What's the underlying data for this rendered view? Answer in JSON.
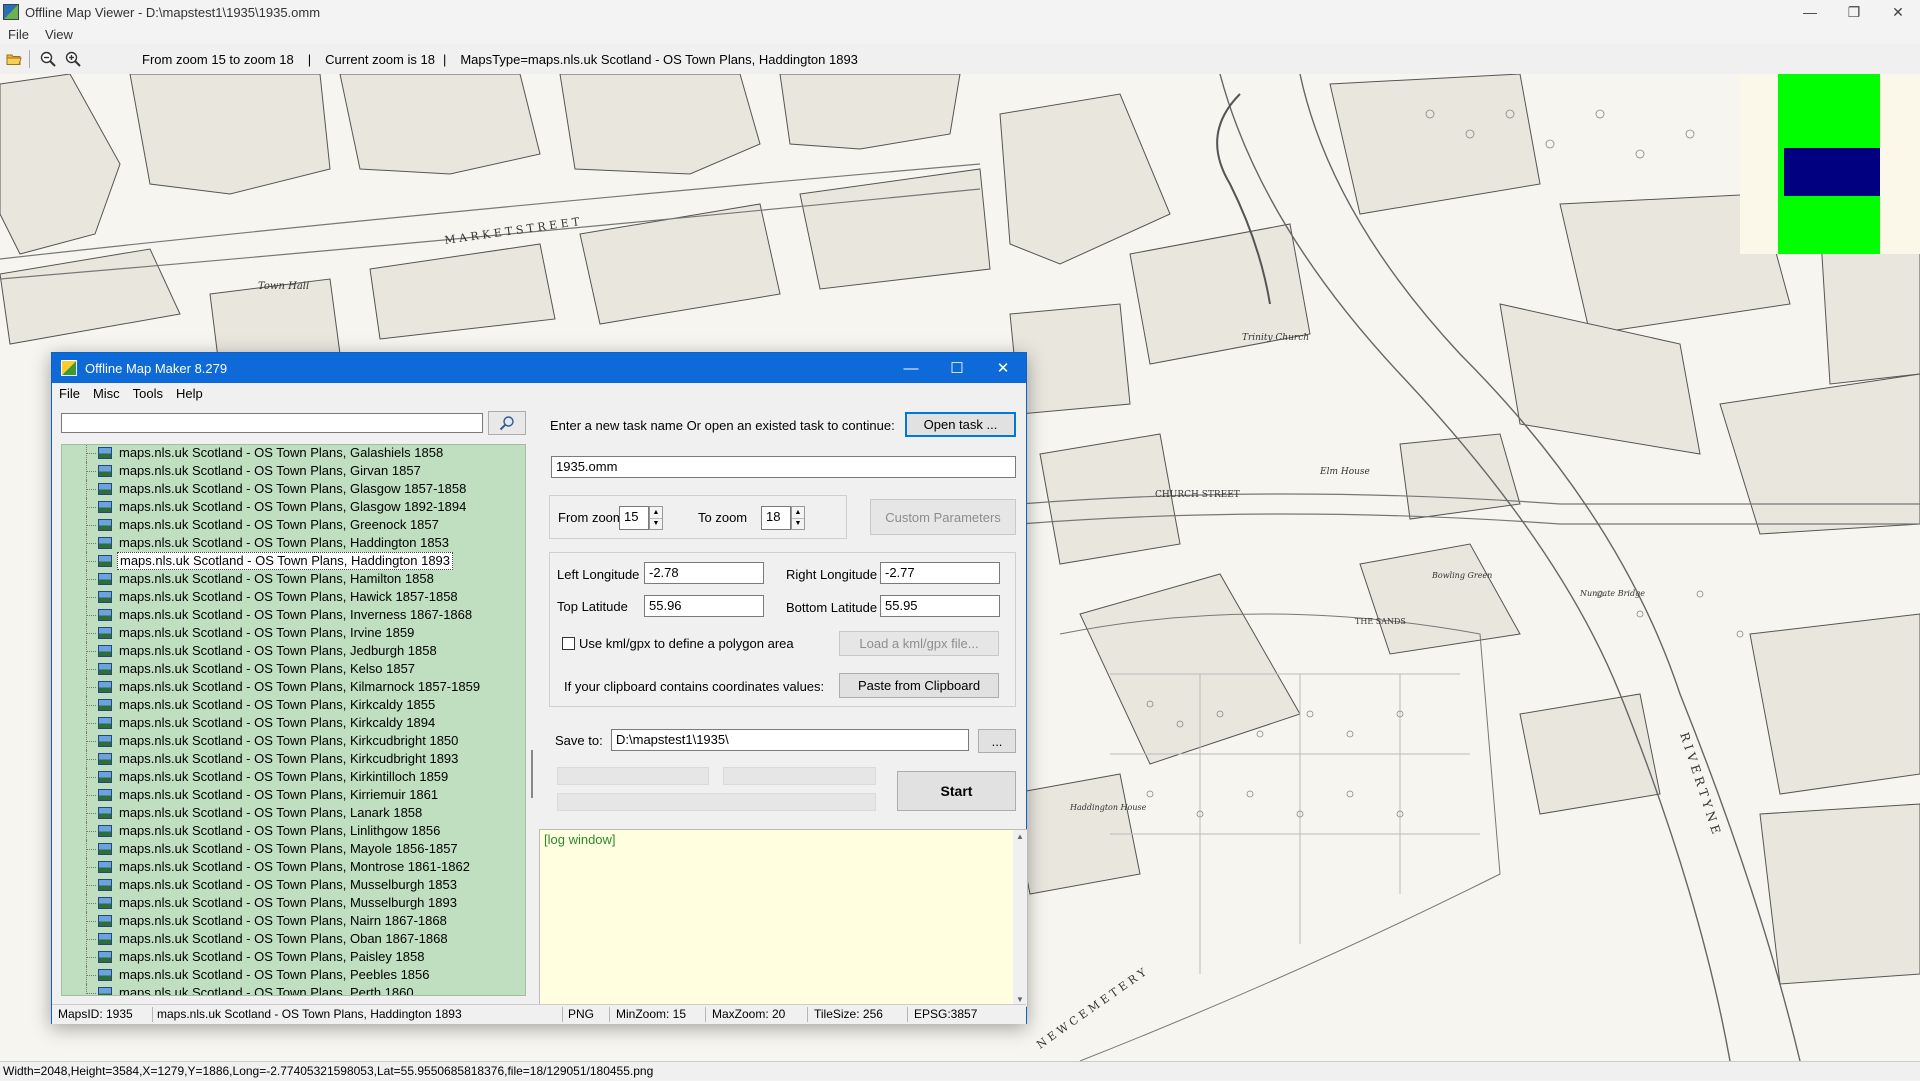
{
  "window": {
    "title": "Offline Map Viewer - D:\\mapstest1\\1935\\1935.omm",
    "controls": {
      "minimize": "—",
      "maximize": "❐",
      "close": "✕"
    }
  },
  "menu": [
    "File",
    "View"
  ],
  "toolbar": {
    "zoom_range": "From zoom 15 to zoom 18",
    "current_zoom": "Current zoom is 18",
    "maps_type": "MapsType=maps.nls.uk Scotland - OS Town Plans, Haddington 1893",
    "icons": [
      "open-folder-icon",
      "zoom-out-icon",
      "zoom-in-icon"
    ]
  },
  "overview_colors": {
    "background": "#fbf8ea",
    "area": "#00ff00",
    "view": "#000080"
  },
  "map_labels": {
    "market_street": "M A R K E T   S T R E E T",
    "church_street": "CHURCH  STREET",
    "town_hall": "Town Hall",
    "trinity_church": "Trinity Church",
    "elm_house": "Elm House",
    "river": "R I V E R   T Y N E",
    "cemetery": "N E W   C E M E T E R Y",
    "haddington_house": "Haddington House",
    "bowling_green": "Bowling Green",
    "nungate_bridge": "Nungate Bridge",
    "the_sands": "THE SANDS"
  },
  "status_bar": "Width=2048,Height=3584,X=1279,Y=1886,Long=-2.77405321598053,Lat=55.9550685818376,file=18/129051/180455.png",
  "dialog": {
    "title": "Offline Map Maker 8.279",
    "controls": {
      "minimize": "—",
      "maximize": "☐",
      "close": "✕"
    },
    "menu": [
      "File",
      "Misc",
      "Tools",
      "Help"
    ],
    "search": {
      "value": "",
      "icon": "search-icon"
    },
    "maps_list": [
      "maps.nls.uk Scotland - OS Town Plans, Galashiels 1858",
      "maps.nls.uk Scotland - OS Town Plans, Girvan 1857",
      "maps.nls.uk Scotland - OS Town Plans, Glasgow 1857-1858",
      "maps.nls.uk Scotland - OS Town Plans, Glasgow 1892-1894",
      "maps.nls.uk Scotland - OS Town Plans, Greenock 1857",
      "maps.nls.uk Scotland - OS Town Plans, Haddington 1853",
      "maps.nls.uk Scotland - OS Town Plans, Haddington 1893",
      "maps.nls.uk Scotland - OS Town Plans, Hamilton 1858",
      "maps.nls.uk Scotland - OS Town Plans, Hawick 1857-1858",
      "maps.nls.uk Scotland - OS Town Plans, Inverness 1867-1868",
      "maps.nls.uk Scotland - OS Town Plans, Irvine 1859",
      "maps.nls.uk Scotland - OS Town Plans, Jedburgh 1858",
      "maps.nls.uk Scotland - OS Town Plans, Kelso 1857",
      "maps.nls.uk Scotland - OS Town Plans, Kilmarnock 1857-1859",
      "maps.nls.uk Scotland - OS Town Plans, Kirkcaldy 1855",
      "maps.nls.uk Scotland - OS Town Plans, Kirkcaldy 1894",
      "maps.nls.uk Scotland - OS Town Plans, Kirkcudbright 1850",
      "maps.nls.uk Scotland - OS Town Plans, Kirkcudbright 1893",
      "maps.nls.uk Scotland - OS Town Plans, Kirkintilloch 1859",
      "maps.nls.uk Scotland - OS Town Plans, Kirriemuir 1861",
      "maps.nls.uk Scotland - OS Town Plans, Lanark 1858",
      "maps.nls.uk Scotland - OS Town Plans, Linlithgow 1856",
      "maps.nls.uk Scotland - OS Town Plans, Mayole 1856-1857",
      "maps.nls.uk Scotland - OS Town Plans, Montrose 1861-1862",
      "maps.nls.uk Scotland - OS Town Plans, Musselburgh 1853",
      "maps.nls.uk Scotland - OS Town Plans, Musselburgh 1893",
      "maps.nls.uk Scotland - OS Town Plans, Nairn 1867-1868",
      "maps.nls.uk Scotland - OS Town Plans, Oban 1867-1868",
      "maps.nls.uk Scotland - OS Town Plans, Paisley 1858",
      "maps.nls.uk Scotland - OS Town Plans, Peebles 1856",
      "maps.nls.uk Scotland - OS Town Plans, Perth 1860"
    ],
    "selected_map": "maps.nls.uk Scotland - OS Town Plans, Haddington 1893",
    "task_prompt": "Enter a new task name Or open an existed task to continue:",
    "open_task_label": "Open task ...",
    "task_name": "1935.omm",
    "from_zoom_label": "From zoom",
    "from_zoom": "15",
    "to_zoom_label": "To zoom",
    "to_zoom": "18",
    "custom_params_label": "Custom Parameters",
    "left_lon_label": "Left Longitude",
    "left_lon": "-2.78",
    "right_lon_label": "Right Longitude",
    "right_lon": "-2.77",
    "top_lat_label": "Top Latitude",
    "top_lat": "55.96",
    "bottom_lat_label": "Bottom Latitude",
    "bottom_lat": "55.95",
    "kml_checkbox_label": "Use kml/gpx to define a polygon area",
    "load_kml_label": "Load a kml/gpx file...",
    "clipboard_text": "If your clipboard contains coordinates values:",
    "paste_label": "Paste from Clipboard",
    "save_to_label": "Save to:",
    "save_to": "D:\\mapstest1\\1935\\",
    "browse_label": "...",
    "start_label": "Start",
    "log_text": "[log window]",
    "status": {
      "maps_id": "MapsID: 1935",
      "map_name": "maps.nls.uk Scotland - OS Town Plans, Haddington 1893",
      "format": "PNG",
      "min_zoom": "MinZoom: 15",
      "max_zoom": "MaxZoom: 20",
      "tile_size": "TileSize: 256",
      "epsg": "EPSG:3857"
    }
  }
}
